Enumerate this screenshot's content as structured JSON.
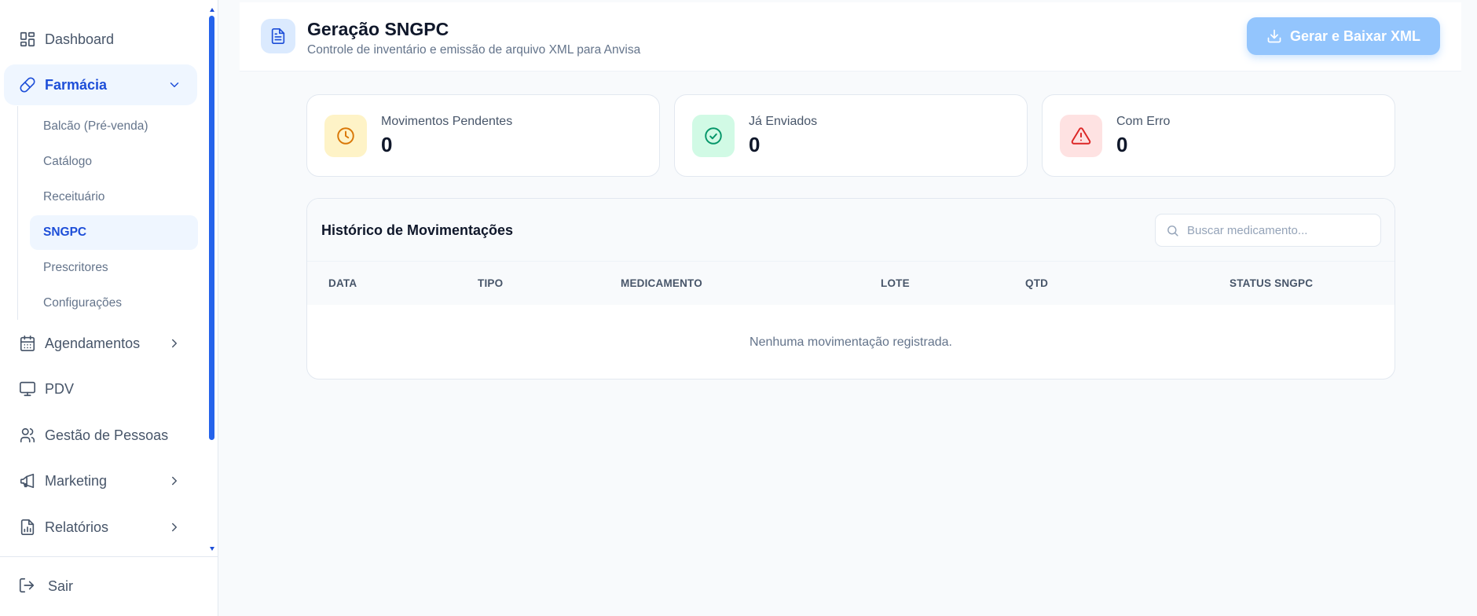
{
  "sidebar": {
    "items": [
      {
        "label": "Dashboard"
      },
      {
        "label": "Farmácia"
      },
      {
        "label": "Agendamentos"
      },
      {
        "label": "PDV"
      },
      {
        "label": "Gestão de Pessoas"
      },
      {
        "label": "Marketing"
      },
      {
        "label": "Relatórios"
      }
    ],
    "subitems": [
      {
        "label": "Balcão (Pré-venda)"
      },
      {
        "label": "Catálogo"
      },
      {
        "label": "Receituário"
      },
      {
        "label": "SNGPC"
      },
      {
        "label": "Prescritores"
      },
      {
        "label": "Configurações"
      }
    ],
    "logout_label": "Sair"
  },
  "header": {
    "title": "Geração SNGPC",
    "subtitle": "Controle de inventário e emissão de arquivo XML para Anvisa",
    "generate_button": "Gerar e Baixar XML"
  },
  "stats": [
    {
      "label": "Movimentos Pendentes",
      "value": "0",
      "icon": "clock-icon",
      "color": "#d97706",
      "bg": "#fef3c7"
    },
    {
      "label": "Já Enviados",
      "value": "0",
      "icon": "check-circle-icon",
      "color": "#059669",
      "bg": "#d1fae5"
    },
    {
      "label": "Com Erro",
      "value": "0",
      "icon": "alert-triangle-icon",
      "color": "#dc2626",
      "bg": "#fee2e2"
    }
  ],
  "history": {
    "title": "Histórico de Movimentações",
    "search_placeholder": "Buscar medicamento...",
    "columns": [
      "DATA",
      "TIPO",
      "MEDICAMENTO",
      "LOTE",
      "QTD",
      "STATUS SNGPC"
    ],
    "rows": [],
    "empty_message": "Nenhuma movimentação registrada."
  },
  "colors": {
    "accent": "#1d4ed8",
    "accent_light": "#eff6ff",
    "button_disabled": "#93c5fd"
  }
}
